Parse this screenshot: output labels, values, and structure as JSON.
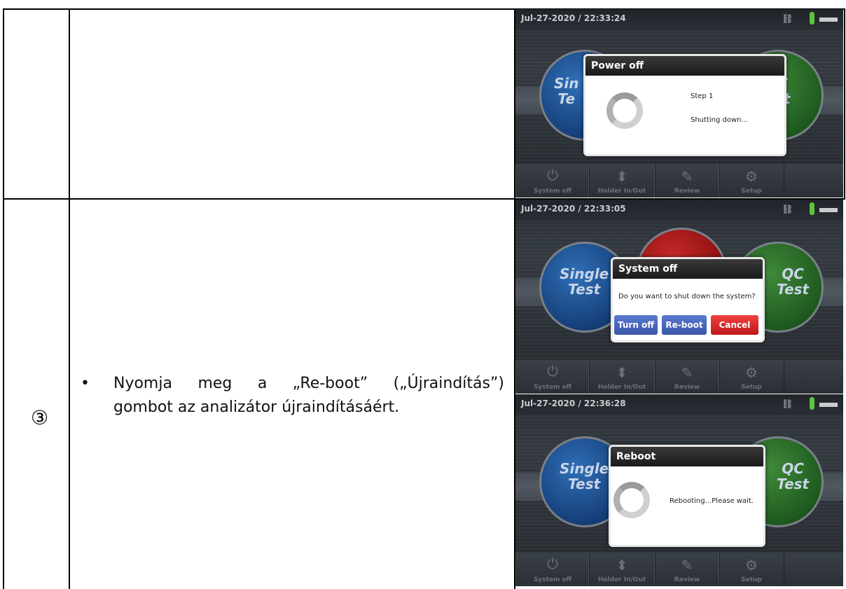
{
  "step": {
    "number": "③",
    "bullet": "•",
    "text_line1": [
      "Nyomja",
      "meg",
      "a",
      "„Re-boot”",
      "(„Újraindítás”)"
    ],
    "text_line2": "gombot az analizátor újraindításáért."
  },
  "screens": [
    {
      "datetime": "Jul-27-2020 / 22:33:24",
      "left_circle": [
        "Sin",
        "Te"
      ],
      "right_circle": [
        "C",
        "st"
      ],
      "dialog": {
        "title": "Power off",
        "line1": "Step 1",
        "line2": "Shutting down..."
      }
    },
    {
      "datetime": "Jul-27-2020 / 22:33:05",
      "left_circle": [
        "Single",
        "Test"
      ],
      "right_circle": [
        "QC",
        "Test"
      ],
      "dialog": {
        "title": "System off",
        "message": "Do you want to shut down the system?",
        "buttons": [
          "Turn off",
          "Re-boot",
          "Cancel"
        ]
      }
    },
    {
      "datetime": "Jul-27-2020 / 22:36:28",
      "left_circle": [
        "Single",
        "Test"
      ],
      "right_circle": [
        "QC",
        "Test"
      ],
      "dialog": {
        "title": "Reboot",
        "message": "Rebooting...Please wait."
      }
    }
  ],
  "toolbar": [
    "System off",
    "Holder In/Out",
    "Review",
    "Setup"
  ],
  "icons": {
    "toolbar": [
      "power-icon",
      "up-down-arrows-icon",
      "edit-icon",
      "gear-icon"
    ],
    "status": [
      "network-icon",
      "thermometer-icon",
      "plug-icon"
    ]
  },
  "colors": {
    "blue_button": "#3a55a8",
    "red_button": "#c01818",
    "thermometer": "#5fc23f"
  }
}
